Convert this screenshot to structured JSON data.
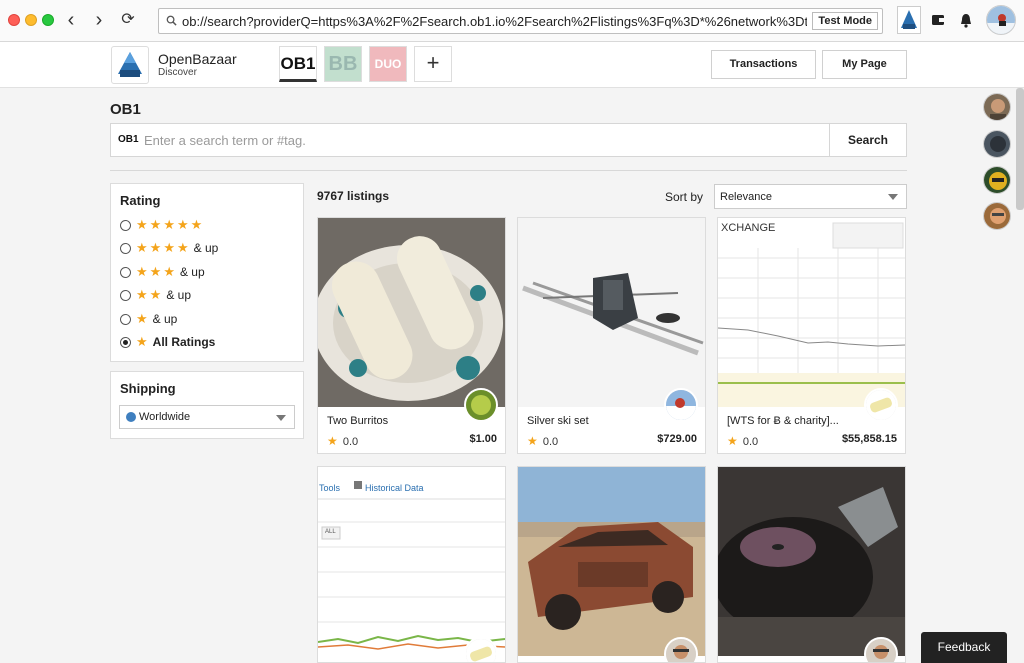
{
  "browser": {
    "url": "ob://search?providerQ=https%3A%2F%2Fsearch.ob1.io%2Fsearch%2Flistings%3Fq%3D*%26network%3Dtestnet%",
    "test_mode": "Test Mode"
  },
  "header": {
    "app_name": "OpenBazaar",
    "app_sub": "Discover",
    "providers": [
      "OB1",
      "BB",
      "DUO"
    ],
    "add_provider": "+",
    "transactions": "Transactions",
    "my_page": "My Page"
  },
  "search": {
    "title": "OB1",
    "provider_tag": "OB1",
    "placeholder": "Enter a search term or #tag.",
    "button": "Search"
  },
  "filters": {
    "rating_title": "Rating",
    "ratings": [
      {
        "stars": 5,
        "label": "",
        "selected": false
      },
      {
        "stars": 4,
        "label": "& up",
        "selected": false
      },
      {
        "stars": 3,
        "label": "& up",
        "selected": false
      },
      {
        "stars": 2,
        "label": "& up",
        "selected": false
      },
      {
        "stars": 1,
        "label": "& up",
        "selected": false
      },
      {
        "stars": 1,
        "label": "All Ratings",
        "selected": true
      }
    ],
    "shipping_title": "Shipping",
    "shipping_value": "Worldwide"
  },
  "listings": {
    "count": "9767 listings",
    "sort_label": "Sort by",
    "sort_value": "Relevance",
    "items": [
      {
        "name": "Two Burritos",
        "rating": "0.0",
        "price": "$1.00"
      },
      {
        "name": "Silver ski set",
        "rating": "0.0",
        "price": "$729.00"
      },
      {
        "name": "[WTS for Ƀ & charity]...",
        "rating": "0.0",
        "price": "$55,858.15"
      },
      {
        "name": "",
        "rating": "",
        "price": ""
      },
      {
        "name": "",
        "rating": "",
        "price": ""
      },
      {
        "name": "",
        "rating": "",
        "price": ""
      }
    ],
    "chart_header": "XCHANGE",
    "tools_tab": "Tools",
    "historical_tab": "Historical Data",
    "all_btn": "ALL"
  },
  "feedback": "Feedback",
  "colors": {
    "star": "#f4a41b",
    "accent": "#222222"
  }
}
